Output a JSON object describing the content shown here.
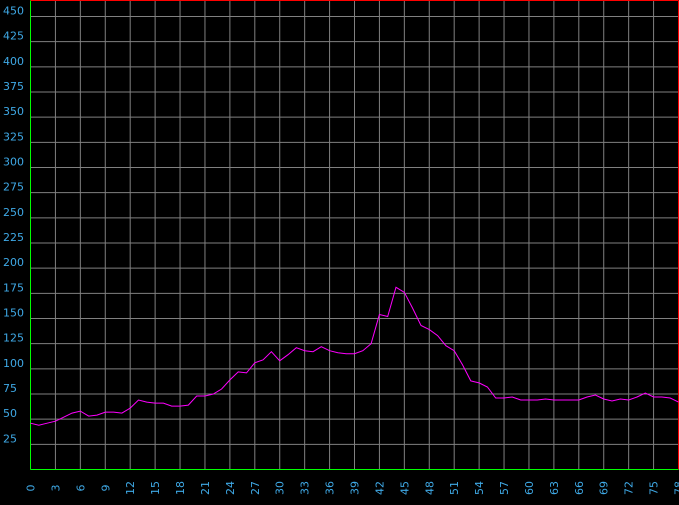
{
  "colors": {
    "background": "#000000",
    "grid": "#808080",
    "line": "#ff00ff",
    "tick_text": "#3fa9e6",
    "frame_top_right": "#ff0000",
    "frame_bottom_left": "#00ff00"
  },
  "chart_data": {
    "type": "line",
    "title": "",
    "xlabel": "",
    "ylabel": "",
    "grid": true,
    "xlim": [
      0,
      78
    ],
    "ylim": [
      0,
      470
    ],
    "x_ticks": [
      "0",
      "3",
      "6",
      "9",
      "12",
      "15",
      "18",
      "21",
      "24",
      "27",
      "30",
      "33",
      "36",
      "39",
      "42",
      "45",
      "48",
      "51",
      "54",
      "57",
      "60",
      "63",
      "66",
      "69",
      "72",
      "75",
      "78"
    ],
    "y_ticks": [
      "25",
      "50",
      "75",
      "100",
      "125",
      "150",
      "175",
      "200",
      "225",
      "250",
      "275",
      "300",
      "325",
      "350",
      "375",
      "400",
      "425",
      "450"
    ],
    "series": [
      {
        "x": [
          0,
          1,
          2,
          3,
          4,
          5,
          6,
          7,
          8,
          9,
          10,
          11,
          12,
          13,
          14,
          15,
          16,
          17,
          18,
          19,
          20,
          21,
          22,
          23,
          24,
          25,
          26,
          27,
          28,
          29,
          30,
          31,
          32,
          33,
          34,
          35,
          36,
          37,
          38,
          39,
          40,
          41,
          42,
          43,
          44,
          45,
          46,
          47,
          48,
          49,
          50,
          51,
          52,
          53,
          54,
          55,
          56,
          57,
          58,
          59,
          60,
          61,
          62,
          63,
          64,
          65,
          66,
          67,
          68,
          69,
          70,
          71,
          72,
          73,
          74,
          75,
          76,
          77,
          78
        ],
        "values": [
          46,
          44,
          46,
          48,
          52,
          56,
          58,
          53,
          54,
          57,
          57,
          56,
          61,
          69,
          67,
          66,
          66,
          63,
          63,
          64,
          73,
          73,
          75,
          80,
          89,
          97,
          96,
          106,
          109,
          117,
          108,
          114,
          121,
          118,
          117,
          122,
          118,
          116,
          115,
          115,
          118,
          125,
          154,
          152,
          181,
          176,
          160,
          143,
          139,
          133,
          123,
          118,
          104,
          88,
          86,
          82,
          71,
          71,
          72,
          69,
          69,
          69,
          70,
          69,
          69,
          69,
          69,
          72,
          74,
          70,
          68,
          70,
          69,
          72,
          76,
          72,
          72,
          71,
          67
        ]
      }
    ]
  }
}
